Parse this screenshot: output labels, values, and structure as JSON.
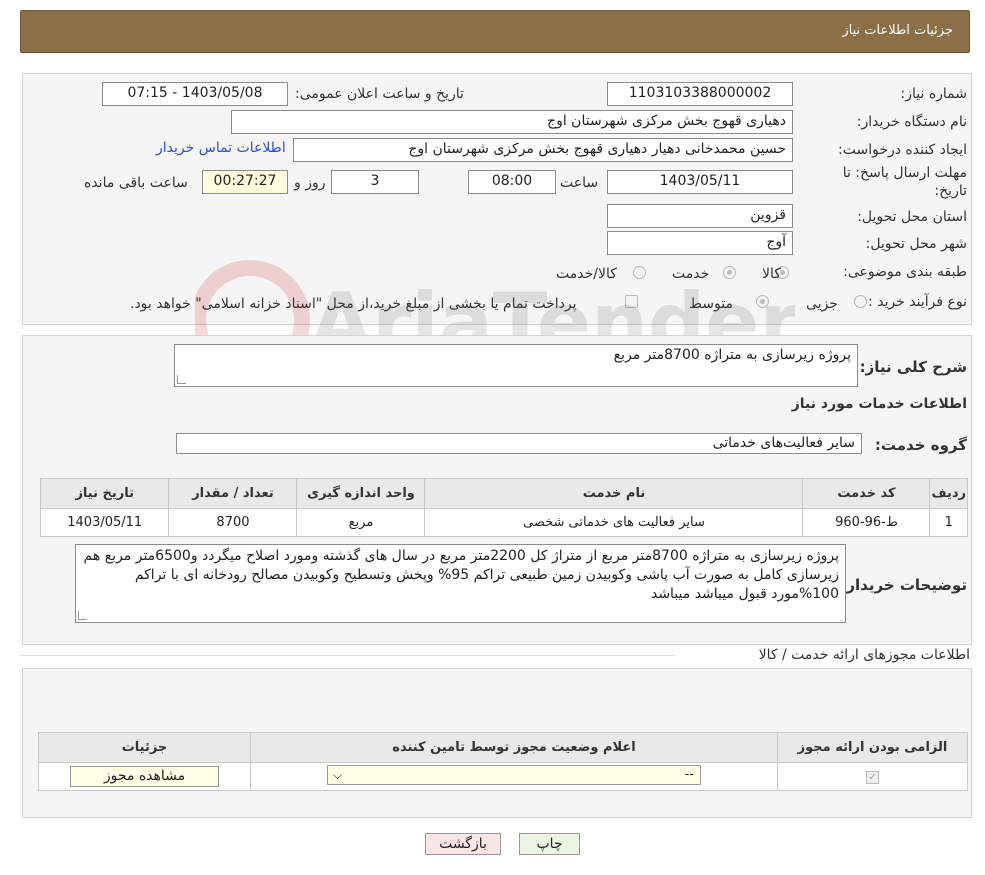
{
  "header": {
    "title": "جزئیات اطلاعات نیاز"
  },
  "fields": {
    "need_number_label": "شماره نیاز:",
    "need_number": "1103103388000002",
    "announce_label": "تاریخ و ساعت اعلان عمومی:",
    "announce_value": "1403/05/08 - 07:15",
    "buyer_org_label": "نام دستگاه خریدار:",
    "buyer_org": "دهیاری قهوج بخش مرکزی شهرستان اوج",
    "creator_label": "ایجاد کننده درخواست:",
    "creator": "حسین محمدخانی دهیار دهیاری قهوج بخش مرکزی شهرستان اوج",
    "contact_link": "اطلاعات تماس خریدار",
    "deadline_label_1": "مهلت ارسال پاسخ: تا",
    "deadline_label_2": "تاریخ:",
    "deadline_date": "1403/05/11",
    "time_label": "ساعت",
    "deadline_time": "08:00",
    "days": "3",
    "days_label": "روز و",
    "remaining": "00:27:27",
    "remaining_label": "ساعت باقی مانده",
    "province_label": "استان محل تحویل:",
    "province": "قزوین",
    "city_label": "شهر محل تحویل:",
    "city": "آوج",
    "category_label": "طبقه بندی موضوعی:",
    "category_options": [
      "کالا",
      "خدمت",
      "کالا/خدمت"
    ],
    "process_label": "نوع فرآیند خرید :",
    "process_options": [
      "جزیی",
      "متوسط"
    ],
    "payment_note": "پرداخت تمام یا بخشی از مبلغ خرید،از محل \"اسناد خزانه اسلامی\" خواهد بود."
  },
  "description": {
    "label": "شرح کلی نیاز:",
    "value": "پروژه زیرسازی به متراژه 8700متر مربع"
  },
  "services": {
    "title": "اطلاعات خدمات مورد نیاز",
    "group_label": "گروه خدمت:",
    "group_value": "سایر فعالیت‌های خدماتی",
    "columns": [
      "ردیف",
      "کد خدمت",
      "نام خدمت",
      "واحد اندازه گیری",
      "تعداد / مقدار",
      "تاریخ نیاز"
    ],
    "rows": [
      [
        "1",
        "ط-96-960",
        "سایر فعالیت های خدماتی شخصی",
        "مربع",
        "8700",
        "1403/05/11"
      ]
    ]
  },
  "buyer_notes": {
    "label": "توضیحات خریدار:",
    "value": "پروژه زیرسازی به متراژه 8700متر مربع از متراژ کل 2200متر مربع در سال های گذشته ومورد اصلاح میگردد و6500متر مربع هم زیرسازی کامل به صورت آب پاشی وکوبیدن زمین طبیعی تراکم 95% وپخش وتسطیح وکوبیدن مصالح رودخانه ای با تراکم 100%مورد قبول میباشد میباشد"
  },
  "permits": {
    "title": "اطلاعات مجوزهای ارائه خدمت / کالا",
    "columns": [
      "الزامی بودن ارائه مجوز",
      "اعلام وضعیت مجوز توسط تامین کننده",
      "جزئیات"
    ],
    "select_value": "--",
    "view_button": "مشاهده مجوز"
  },
  "buttons": {
    "print": "چاپ",
    "back": "بازگشت"
  },
  "watermark": "AriaTender.neT"
}
